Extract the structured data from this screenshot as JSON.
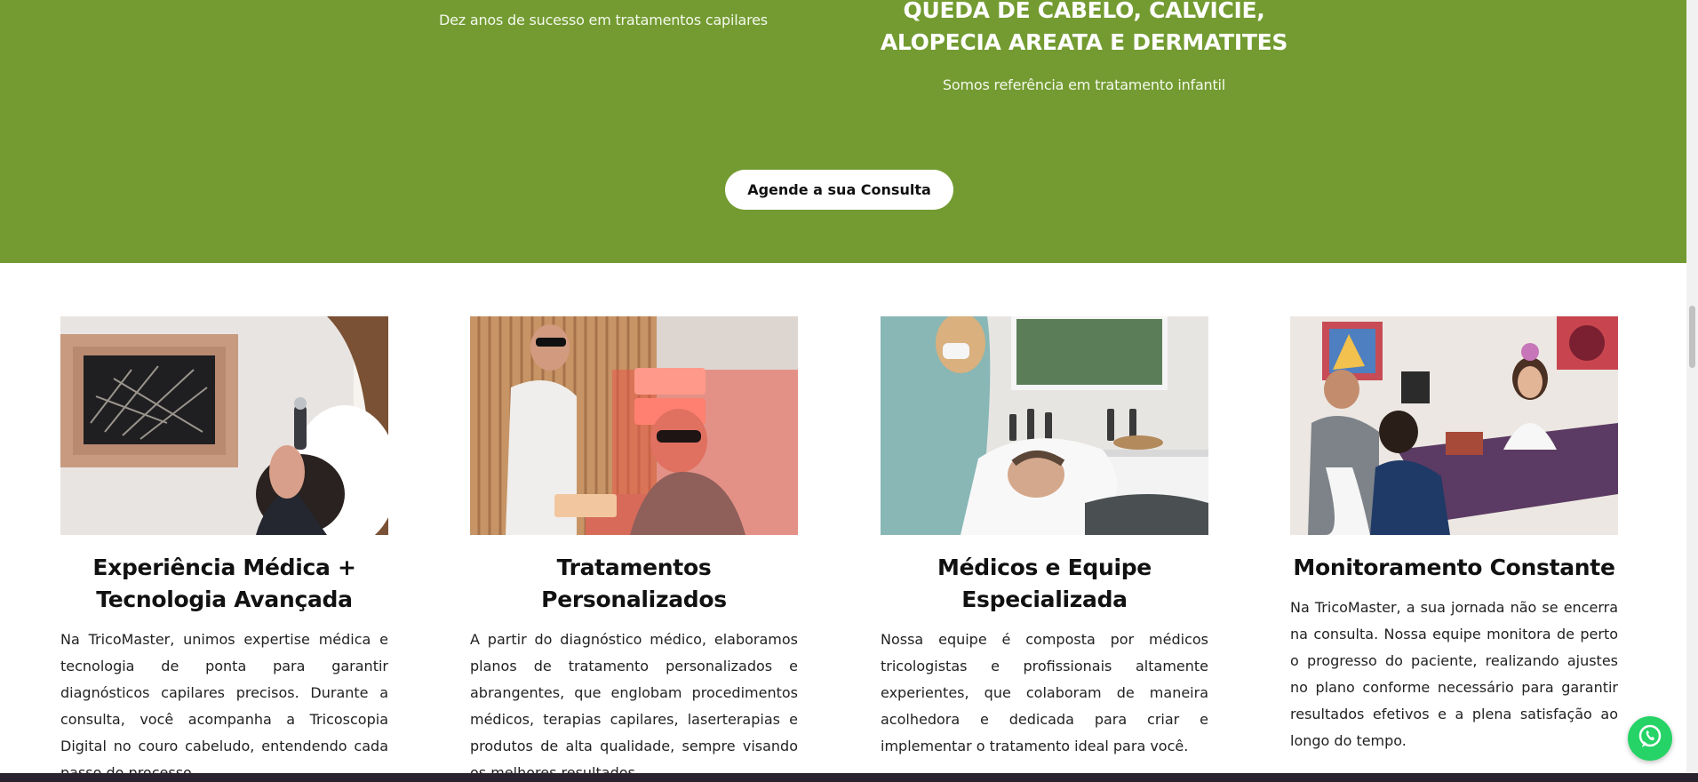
{
  "hero": {
    "left_text": "Dez anos de sucesso em tratamentos capilares",
    "title": "QUEDA DE CABELO, CALVÍCIE, ALOPECIA AREATA E DERMATITES",
    "subtitle": "Somos referência em tratamento infantil",
    "cta_label": "Agende a sua Consulta"
  },
  "colors": {
    "brand_green": "#739b31",
    "whatsapp_green": "#25d366"
  },
  "cards": [
    {
      "title": "Experiência Médica + Tecnologia Avançada",
      "text": "Na TricoMaster, unimos expertise médica e tecnologia de ponta para garantir diagnósticos capilares precisos. Durante a consulta, você acompanha a Tricoscopia Digital no couro cabeludo, entendendo cada passo do processo."
    },
    {
      "title": "Tratamentos Personalizados",
      "text": "A partir do diagnóstico médico, elaboramos planos de tratamento personalizados e abrangentes, que englobam procedimentos médicos, terapias capilares, laserterapias e produtos de alta qualidade, sempre visando os melhores resultados."
    },
    {
      "title": "Médicos e Equipe Especializada",
      "text": "Nossa equipe é composta por médicos tricologistas e profissionais altamente experientes, que colaboram de maneira acolhedora e dedicada para criar e implementar o tratamento ideal para você."
    },
    {
      "title": "Monitoramento Constante",
      "text": "Na TricoMaster, a sua jornada não se encerra na consulta. Nossa equipe monitora de perto o progresso do paciente, realizando ajustes no plano conforme necessário para garantir resultados efetivos e a plena satisfação ao longo do tempo."
    }
  ],
  "whatsapp": {
    "icon": "whatsapp-icon"
  }
}
